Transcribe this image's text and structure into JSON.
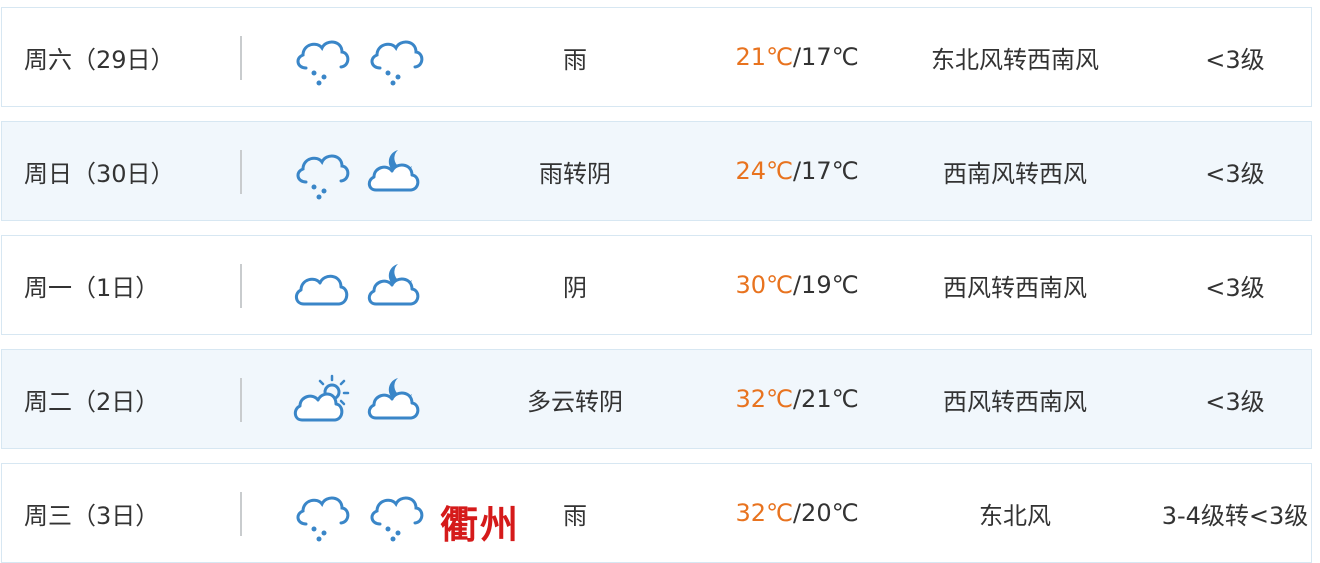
{
  "colors": {
    "high_temp": "#e8731f",
    "icon_blue": "#3a86c8",
    "watermark": "#d51a1a"
  },
  "rows": [
    {
      "day": "周六（29日）",
      "icon_day": "rain-cloud-icon",
      "icon_night": "rain-cloud-icon",
      "desc": "雨",
      "high": "21℃",
      "sep": "/",
      "low": "17℃",
      "wind": "东北风转西南风",
      "level": "<3级"
    },
    {
      "day": "周日（30日）",
      "icon_day": "rain-cloud-icon",
      "icon_night": "moon-cloud-icon",
      "desc": "雨转阴",
      "high": "24℃",
      "sep": "/",
      "low": "17℃",
      "wind": "西南风转西风",
      "level": "<3级"
    },
    {
      "day": "周一（1日）",
      "icon_day": "cloud-icon",
      "icon_night": "moon-cloud-icon",
      "desc": "阴",
      "high": "30℃",
      "sep": "/",
      "low": "19℃",
      "wind": "西风转西南风",
      "level": "<3级"
    },
    {
      "day": "周二（2日）",
      "icon_day": "sun-cloud-icon",
      "icon_night": "moon-cloud-icon",
      "desc": "多云转阴",
      "high": "32℃",
      "sep": "/",
      "low": "21℃",
      "wind": "西风转西南风",
      "level": "<3级"
    },
    {
      "day": "周三（3日）",
      "icon_day": "rain-cloud-icon",
      "icon_night": "rain-cloud-icon",
      "desc": "雨",
      "high": "32℃",
      "sep": "/",
      "low": "20℃",
      "wind": "东北风",
      "level": "3-4级转<3级"
    }
  ],
  "watermark": "衢州"
}
